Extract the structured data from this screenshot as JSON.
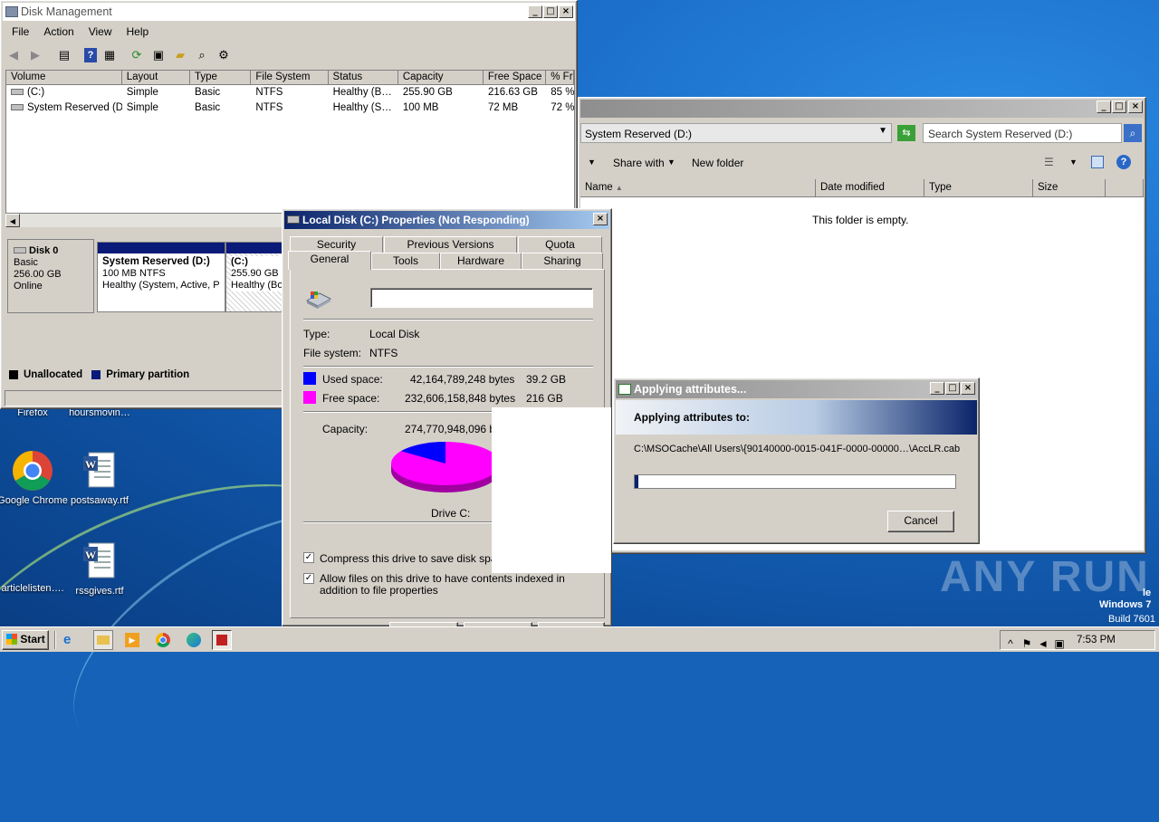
{
  "disk_mgmt": {
    "title": "Disk Management",
    "menu": [
      "File",
      "Action",
      "View",
      "Help"
    ],
    "columns": [
      "Volume",
      "Layout",
      "Type",
      "File System",
      "Status",
      "Capacity",
      "Free Space",
      "% Fr"
    ],
    "rows": [
      [
        "(C:)",
        "Simple",
        "Basic",
        "NTFS",
        "Healthy (B…",
        "255.90 GB",
        "216.63 GB",
        "85 %"
      ],
      [
        "System Reserved (D:)",
        "Simple",
        "Basic",
        "NTFS",
        "Healthy (S…",
        "100 MB",
        "72 MB",
        "72 %"
      ]
    ],
    "disk0": {
      "name": "Disk 0",
      "type": "Basic",
      "size": "256.00 GB",
      "status": "Online"
    },
    "part1": {
      "name": "System Reserved  (D:)",
      "size": "100 MB NTFS",
      "status": "Healthy (System, Active, P"
    },
    "part2": {
      "name": "(C:)",
      "size": "255.90 GB N",
      "status": "Healthy (Bo"
    },
    "legend": {
      "unallocated": "Unallocated",
      "primary": "Primary partition"
    }
  },
  "explorer": {
    "address": "System Reserved (D:)",
    "search_placeholder": "Search System Reserved (D:)",
    "share_with": "Share with",
    "new_folder": "New folder",
    "columns": [
      "Name",
      "Date modified",
      "Type",
      "Size"
    ],
    "empty_text": "This folder is empty."
  },
  "properties": {
    "title": "Local Disk (C:) Properties (Not Responding)",
    "tabs_top": [
      "Security",
      "Previous Versions",
      "Quota"
    ],
    "tabs_bottom": [
      "General",
      "Tools",
      "Hardware",
      "Sharing"
    ],
    "type_label": "Type:",
    "type_value": "Local Disk",
    "fs_label": "File system:",
    "fs_value": "NTFS",
    "used_label": "Used space:",
    "used_bytes": "42,164,789,248 bytes",
    "used_gb": "39.2 GB",
    "free_label": "Free space:",
    "free_bytes": "232,606,158,848 bytes",
    "free_gb": "216 GB",
    "capacity_label": "Capacity:",
    "capacity_bytes": "274,770,948,096 byt",
    "drive_label": "Drive C:",
    "compress_label": "Compress this drive to save disk space",
    "index_label": "Allow files on this drive to have contents indexed in addition to file properties",
    "used_fraction": 0.153,
    "colors": {
      "used": "#0000ff",
      "free": "#ff00ff"
    }
  },
  "applying": {
    "title": "Applying attributes...",
    "heading": "Applying attributes to:",
    "path": "C:\\MSOCache\\All Users\\{90140000-0015-041F-0000-00000…\\AccLR.cab",
    "progress": 0.01,
    "cancel": "Cancel"
  },
  "desktop": {
    "icons": [
      "Firefox",
      "hoursmovin…",
      "Google Chrome",
      "postsaway.rtf",
      "articlelisten….",
      "rssgives.rtf"
    ],
    "watermark": "ANY RUN",
    "os_line1": "le",
    "os_line2": "Windows 7",
    "build": "Build 7601"
  },
  "taskbar": {
    "start": "Start",
    "time": "7:53 PM"
  }
}
